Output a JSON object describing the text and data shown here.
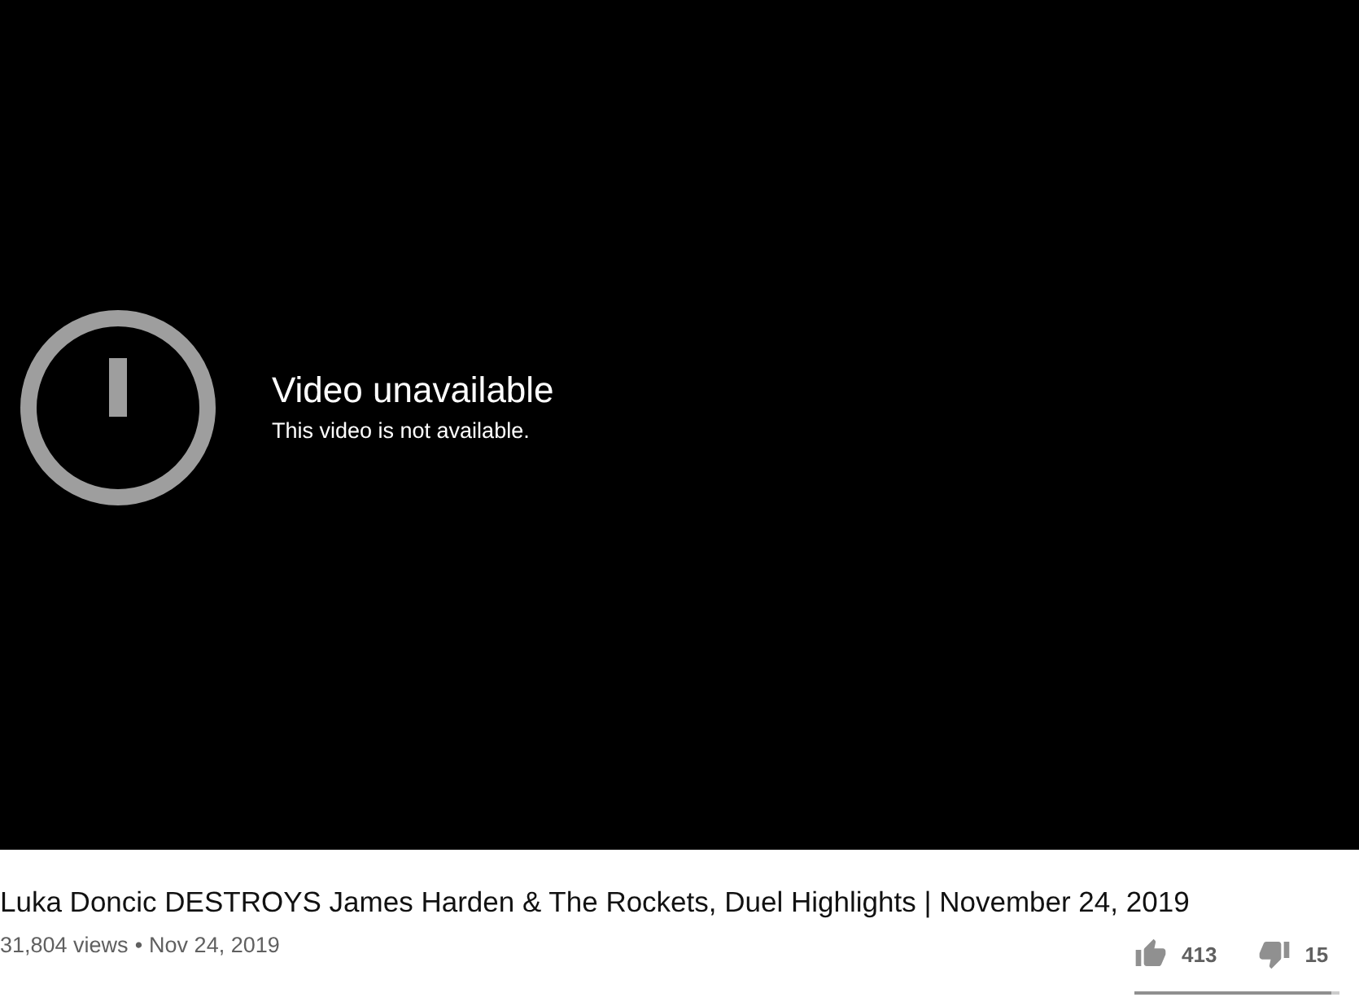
{
  "player": {
    "error_title": "Video unavailable",
    "error_message": "This video is not available."
  },
  "video": {
    "title": "Luka Doncic DESTROYS James Harden & The Rockets, Duel Highlights | November 24, 2019",
    "views": "31,804 views",
    "separator": "•",
    "date": "Nov 24, 2019"
  },
  "actions": {
    "likes": "413",
    "dislikes": "15",
    "level": 0.96
  }
}
